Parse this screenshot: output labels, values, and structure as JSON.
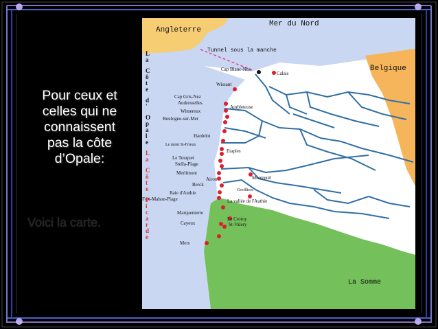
{
  "slide": {
    "intro_lines": [
      "Pour ceux et",
      "celles qui ne",
      "connaissent",
      "pas la côte",
      "d’Opale:"
    ],
    "subtitle": "Voici la carte."
  },
  "map": {
    "sea_labels": {
      "north_sea": "Mer du Nord",
      "england": "Angleterre",
      "tunnel": "Tunnel sous la manche",
      "belgium": "Belgique",
      "somme": "La Somme"
    },
    "vertical_titles": {
      "opale": "La Côte d'Opale",
      "picarde": "La Côte Picarde"
    },
    "towns": [
      "Calais",
      "Cap Blanc-Nez",
      "Wissant",
      "Cap Gris-Nez",
      "Audresselles",
      "Ambleteuse",
      "Wimereux",
      "Boulogne-sur-Mer",
      "Hardelot",
      "Le mont St-Frieux",
      "Etaples",
      "Le Touquet",
      "Stella-Plage",
      "Merlimont",
      "Montreuil",
      "Airon",
      "Berck",
      "Groffliers",
      "Baie d'Authie",
      "Fort-Mahon-Plage",
      "La vallée de l'Authie",
      "Marquenterre",
      "Le Crotoy",
      "Cayeux",
      "St-Valery",
      "Mers"
    ],
    "colors": {
      "sea": "#c9d7f2",
      "land": "#ffffff",
      "england": "#f6cd72",
      "somme": "#74c05a",
      "rivers": "#2f6fa6",
      "towns": "#dd1e2e",
      "tunnel": "#e0409a"
    }
  }
}
